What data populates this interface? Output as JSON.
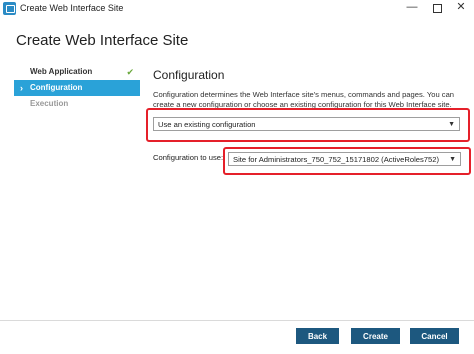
{
  "window": {
    "title": "Create Web Interface Site",
    "controls": {
      "minimize": "—",
      "close": "✕"
    }
  },
  "heading": "Create Web Interface Site",
  "sidebar": {
    "items": [
      {
        "label": "Web Application",
        "state": "completed",
        "check": "✔"
      },
      {
        "label": "Configuration",
        "state": "active",
        "chevron": "›"
      },
      {
        "label": "Execution",
        "state": "pending"
      }
    ]
  },
  "main": {
    "section_title": "Configuration",
    "description": "Configuration determines the Web Interface site's menus, commands and pages. You can create a new configuration or choose an existing configuration for this Web Interface site.",
    "mode_select": {
      "value": "Use an existing configuration",
      "arrow": "▼"
    },
    "config_label": "Configuration to use:",
    "config_select": {
      "value": "Site for Administrators_750_752_15171802 (ActiveRoles752)",
      "arrow": "▼"
    }
  },
  "footer": {
    "back": "Back",
    "create": "Create",
    "cancel": "Cancel"
  },
  "colors": {
    "accent": "#2aa2d8",
    "button": "#1d587f",
    "highlight": "#e5202a",
    "check": "#6aa83c"
  }
}
